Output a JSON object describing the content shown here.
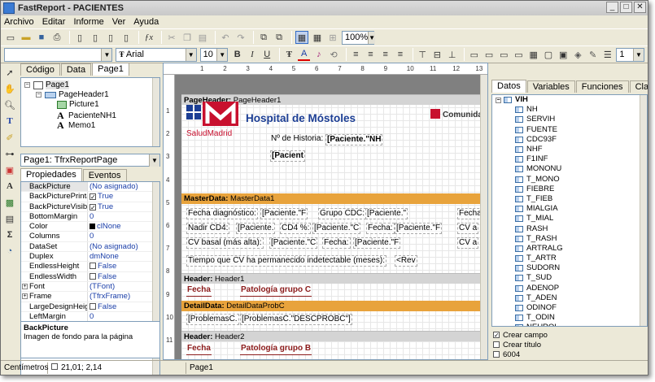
{
  "window": {
    "title": "FastReport - PACIENTES",
    "minimize": "_",
    "maximize": "□",
    "close": "✕"
  },
  "menu": [
    "Archivo",
    "Editar",
    "Informe",
    "Ver",
    "Ayuda"
  ],
  "toolbar1": {
    "zoom": "100%"
  },
  "toolbar2": {
    "style_value": "",
    "font_name": "Arial",
    "font_size": "10",
    "bold": "B",
    "italic": "I",
    "underline": "U",
    "frame_width": "1"
  },
  "left_tabs": [
    "Código",
    "Data",
    "Page1"
  ],
  "tree": {
    "page": "Page1",
    "page_header": "PageHeader1",
    "picture": "Picture1",
    "memo_nh": "PacienteNH1",
    "memo": "Memo1"
  },
  "object_combo": "Page1: TfrxReportPage",
  "inspector_tabs": [
    "Propiedades",
    "Eventos"
  ],
  "props": [
    {
      "name": "BackPicture",
      "value": "(No asignado)"
    },
    {
      "name": "BackPicturePrintable",
      "value": "True",
      "check": true
    },
    {
      "name": "BackPictureVisible",
      "value": "True",
      "check": true
    },
    {
      "name": "BottomMargin",
      "value": "0"
    },
    {
      "name": "Color",
      "value": "clNone",
      "swatch": true
    },
    {
      "name": "Columns",
      "value": "0"
    },
    {
      "name": "DataSet",
      "value": "(No asignado)"
    },
    {
      "name": "Duplex",
      "value": "dmNone"
    },
    {
      "name": "EndlessHeight",
      "value": "False",
      "check": false
    },
    {
      "name": "EndlessWidth",
      "value": "False",
      "check": false
    },
    {
      "name": "Font",
      "value": "(TFont)",
      "expand": true
    },
    {
      "name": "Frame",
      "value": "(TfrxFrame)",
      "expand": true
    },
    {
      "name": "LargeDesignHeight",
      "value": "False",
      "check": false
    },
    {
      "name": "LeftMargin",
      "value": "0"
    }
  ],
  "help": {
    "title": "BackPicture",
    "text": "Imagen de fondo para la página"
  },
  "ruler": [
    "1",
    "2",
    "3",
    "4",
    "5",
    "6",
    "7",
    "8",
    "9",
    "10",
    "11",
    "12",
    "13"
  ],
  "ruler_v": [
    "1",
    "2",
    "3",
    "4",
    "5",
    "6",
    "7",
    "8",
    "9",
    "10",
    "11",
    "12"
  ],
  "report": {
    "page_header_band": "PageHeader:",
    "page_header_name": "PageHeader1",
    "hospital": "Hospital de Móstoles",
    "salud": "SaludMadrid",
    "comunidad": "Comunida",
    "historia_label": "Nº de Historia:",
    "historia_field": "[Paciente.\"NH",
    "paciente_field": "[Pacient",
    "master_band": "MasterData:",
    "master_name": "MasterData1",
    "m_fecha_diag": "Fecha diagnóstico:",
    "m_pac_f": "[Paciente.\"F",
    "m_grupo_cdc": "Grupo CDC:",
    "m_pac_q": "[Paciente.\"",
    "m_fecha_r": "Fecha",
    "m_nadir": "Nadir CD4:",
    "m_pac_a": "[Paciente.",
    "m_cd4pct": "CD4 %:",
    "m_pac_c": "[Paciente.\"C",
    "m_fecha2": "Fecha:",
    "m_pac_f2": "[Paciente.\"F",
    "m_cd4_r": "CV a",
    "m_cv_basal": "CV basal (más alta):",
    "m_pac_c2": "[Paciente.\"C",
    "m_fecha3": "Fecha:",
    "m_pac_f3": "[Paciente.\"F",
    "m_cv_r": "CV a",
    "m_tiempo": "Tiempo que CV ha permanecido indetectable (meses):",
    "m_rev": "<Rev",
    "header_band": "Header:",
    "header_name": "Header1",
    "h_fecha": "Fecha",
    "h_pat": "Patología grupo C",
    "detail_band": "DetailData:",
    "detail_name": "DetailDataProbC",
    "d_prob": "[ProblemasC.",
    "d_desc": "[ProblemasC.\"DESCPROBC\"]",
    "header2_band": "Header:",
    "header2_name": "Header2",
    "h2_fecha": "Fecha",
    "h2_pat": "Patología grupo B"
  },
  "right_tabs": [
    "Datos",
    "Variables",
    "Funciones",
    "Clases"
  ],
  "data_root": "VIH",
  "data_fields": [
    "NH",
    "SERVIH",
    "FUENTE",
    "CDC93F",
    "NHF",
    "F1INF",
    "MONONU",
    "T_MONO",
    "FIEBRE",
    "T_FIEB",
    "MIALGIA",
    "T_MIAL",
    "RASH",
    "T_RASH",
    "ARTRALG",
    "T_ARTR",
    "SUDORN",
    "T_SUD",
    "ADENOP",
    "T_ADEN",
    "ODINOF",
    "T_ODIN",
    "NEUROL"
  ],
  "options": [
    {
      "label": "Crear campo",
      "checked": true
    },
    {
      "label": "Crear título",
      "checked": false
    },
    {
      "label": "6004",
      "checked": false
    }
  ],
  "status": {
    "units": "Centímetros",
    "coords": "21,01; 2,14",
    "page": "Page1"
  },
  "colors": {
    "band_gold": "#e8a33c",
    "header_text": "#8b1a1a",
    "hospital_blue": "#1c3e94",
    "madrid_red": "#c8102e"
  }
}
